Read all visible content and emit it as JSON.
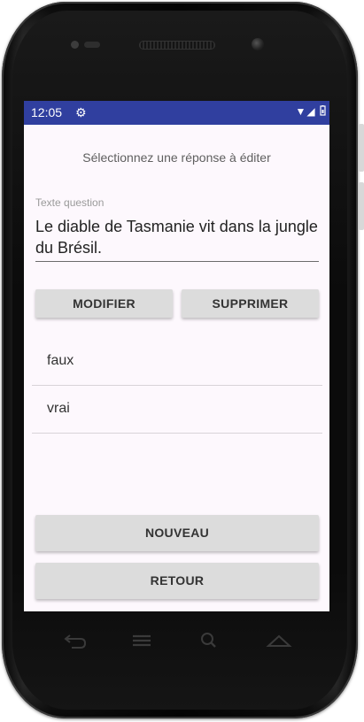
{
  "status_bar": {
    "time": "12:05",
    "settings_icon": "gear-icon",
    "wifi_icon": "wifi-icon",
    "signal_icon": "signal-icon",
    "battery_icon": "battery-icon",
    "color": "#303f9f"
  },
  "screen": {
    "prompt": "Sélectionnez une réponse à éditer",
    "question_field": {
      "label": "Texte question",
      "value": "Le diable de Tasmanie vit dans la jungle du Brésil."
    },
    "buttons": {
      "modify": "MODIFIER",
      "delete": "SUPPRIMER",
      "new": "NOUVEAU",
      "back": "RETOUR"
    },
    "answers": [
      {
        "label": "faux"
      },
      {
        "label": "vrai"
      }
    ],
    "background": "#fdf8fd"
  },
  "nav_bar": {
    "back_icon": "back-icon",
    "menu_icon": "menu-icon",
    "search_icon": "search-icon",
    "home_icon": "home-icon"
  }
}
